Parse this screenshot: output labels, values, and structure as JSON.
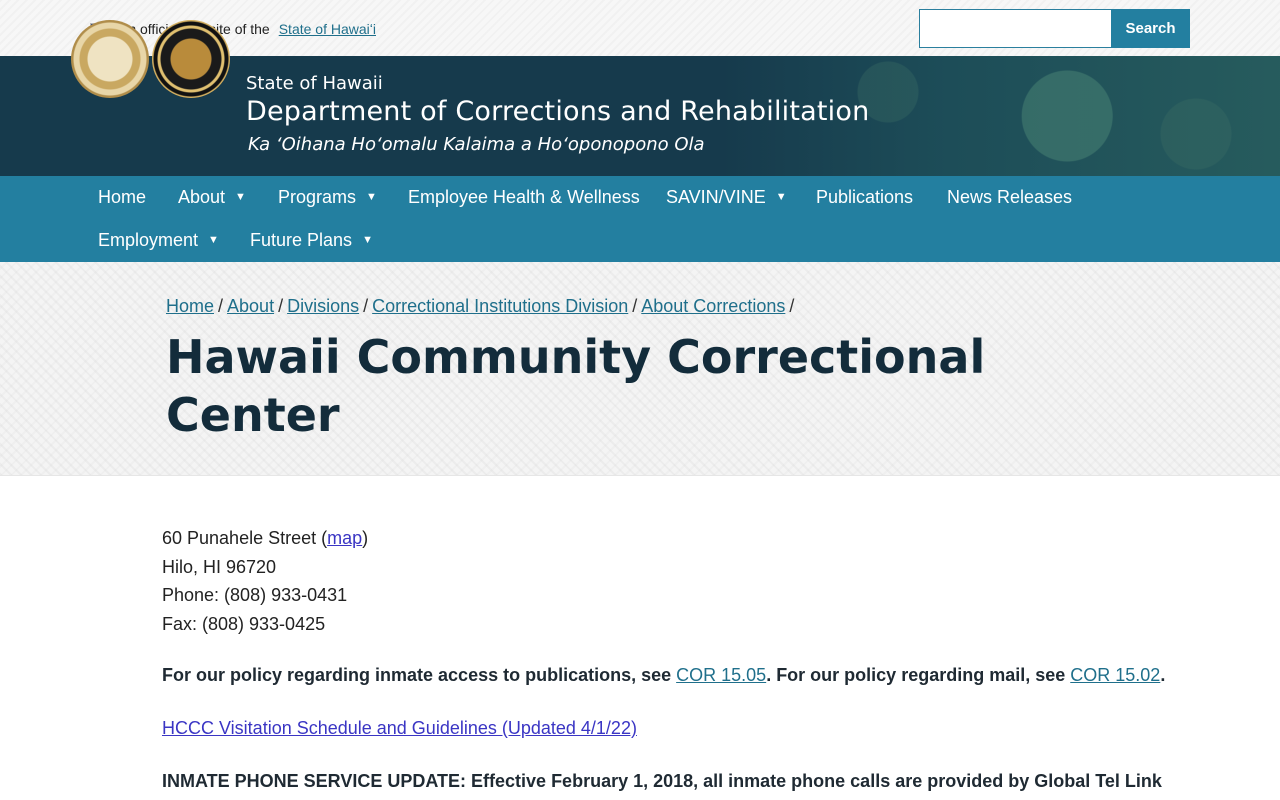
{
  "official_bar": {
    "text": "An official website of the",
    "link": "State of Hawaiʻi"
  },
  "search": {
    "placeholder": "",
    "button_label": "Search"
  },
  "header": {
    "state": "State of Hawaii",
    "department": "Department of Corrections and Rehabilitation",
    "hawaiian_name": "Ka ʻOihana Hoʻomalu Kalaima a Hoʻoponopono Ola"
  },
  "nav": {
    "items": [
      {
        "label": "Home",
        "dropdown": false
      },
      {
        "label": "About",
        "dropdown": true
      },
      {
        "label": "Programs",
        "dropdown": true
      },
      {
        "label": "Employee Health & Wellness",
        "dropdown": false
      },
      {
        "label": "SAVIN/VINE",
        "dropdown": true
      },
      {
        "label": "Publications",
        "dropdown": false
      },
      {
        "label": "News Releases",
        "dropdown": false
      },
      {
        "label": "Employment",
        "dropdown": true
      },
      {
        "label": "Future Plans",
        "dropdown": true
      }
    ],
    "caret": "▼"
  },
  "breadcrumb": {
    "items": [
      "Home",
      "About",
      "Divisions",
      "Correctional Institutions Division",
      "About Corrections"
    ],
    "separator": "/"
  },
  "page_title": "Hawaii Community Correctional Center",
  "address": {
    "street": "60 Punahele Street (",
    "map_link": "map",
    "street_close": ")",
    "city": "Hilo, HI 96720",
    "phone": "Phone: (808) 933-0431",
    "fax": "Fax: (808) 933-0425"
  },
  "policy": {
    "part1": "For our policy regarding inmate access to publications, see ",
    "link1": "COR 15.05",
    "part2": ". For our policy regarding mail, see ",
    "link2": "COR 15.02",
    "part3": "."
  },
  "visitation_link": "HCCC Visitation Schedule and Guidelines (Updated 4/1/22)",
  "phone_update": "INMATE PHONE SERVICE UPDATE: Effective February 1, 2018, all inmate phone calls are provided by Global Tel Link",
  "colors": {
    "header_bg": "#163a4c",
    "nav_bg": "#237fa0",
    "link": "#1f6f8b",
    "visited_link": "#3a35c4",
    "title": "#132c3b"
  }
}
